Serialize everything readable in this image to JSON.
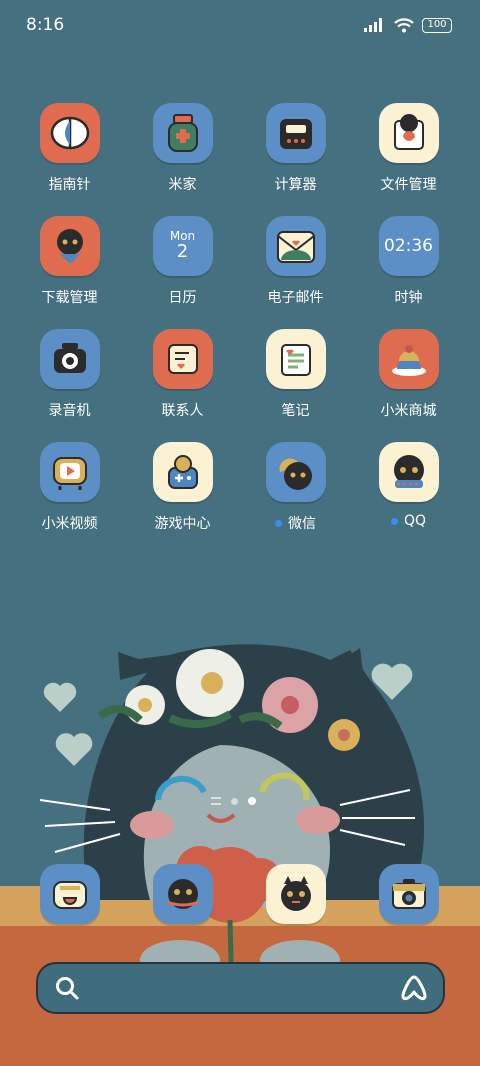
{
  "status_bar": {
    "time": "8:16",
    "battery": "100"
  },
  "apps": [
    {
      "label": "指南针",
      "icon": "compass-icon",
      "bg": "#e06c4f",
      "badge": false
    },
    {
      "label": "米家",
      "icon": "mi-home-icon",
      "bg": "#5b8fc6",
      "badge": false
    },
    {
      "label": "计算器",
      "icon": "calculator-icon",
      "bg": "#5b8fc6",
      "badge": false
    },
    {
      "label": "文件管理",
      "icon": "file-manager-icon",
      "bg": "#fbf1d3",
      "badge": false
    },
    {
      "label": "下载管理",
      "icon": "download-manager-icon",
      "bg": "#e06c4f",
      "badge": false
    },
    {
      "label": "日历",
      "icon": "calendar-icon",
      "bg": "#5b8fc6",
      "badge": false,
      "month": "Mon",
      "day": "2"
    },
    {
      "label": "电子邮件",
      "icon": "email-icon",
      "bg": "#5b8fc6",
      "badge": false
    },
    {
      "label": "时钟",
      "icon": "clock-icon",
      "bg": "#5b8fc6",
      "badge": false,
      "clock": "02:36"
    },
    {
      "label": "录音机",
      "icon": "recorder-icon",
      "bg": "#5b8fc6",
      "badge": false
    },
    {
      "label": "联系人",
      "icon": "contacts-icon",
      "bg": "#e06c4f",
      "badge": false
    },
    {
      "label": "笔记",
      "icon": "notes-icon",
      "bg": "#fbf1d3",
      "badge": false
    },
    {
      "label": "小米商城",
      "icon": "mi-store-icon",
      "bg": "#e06c4f",
      "badge": false
    },
    {
      "label": "小米视频",
      "icon": "mi-video-icon",
      "bg": "#5b8fc6",
      "badge": false
    },
    {
      "label": "游戏中心",
      "icon": "game-center-icon",
      "bg": "#fbf1d3",
      "badge": false
    },
    {
      "label": "微信",
      "icon": "wechat-icon",
      "bg": "#5b8fc6",
      "badge": true
    },
    {
      "label": "QQ",
      "icon": "qq-icon",
      "bg": "#fbf1d3",
      "badge": true
    }
  ],
  "dock": [
    {
      "icon": "phone-icon",
      "bg": "#5b8fc6"
    },
    {
      "icon": "messages-icon",
      "bg": "#5b8fc6"
    },
    {
      "icon": "browser-icon",
      "bg": "#fbf1d3"
    },
    {
      "icon": "camera-icon",
      "bg": "#5b8fc6"
    }
  ],
  "colors": {
    "background": "#45707f",
    "accent_blue": "#5b8fc6",
    "accent_orange": "#e06c4f",
    "accent_cream": "#fbf1d3",
    "badge": "#3a8df5"
  },
  "search_bar": {
    "left_icon": "search-icon",
    "right_icon": "assistant-icon"
  }
}
